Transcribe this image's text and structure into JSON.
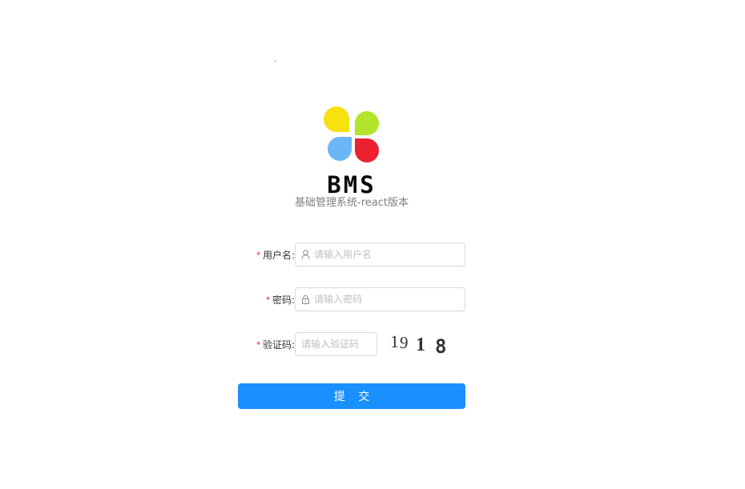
{
  "brand": {
    "name": "BMS",
    "subtitle": "基础管理系统-react版本",
    "logo_colors": [
      "#f7e210",
      "#b1e42a",
      "#6ab6f7",
      "#ec2230"
    ]
  },
  "form": {
    "username": {
      "label": "用户名:",
      "required_mark": "*",
      "placeholder": "请输入用户名",
      "value": "",
      "icon": "user-icon"
    },
    "password": {
      "label": "密码:",
      "required_mark": "*",
      "placeholder": "请输入密码",
      "value": "",
      "icon": "lock-icon"
    },
    "captcha": {
      "label": "验证码:",
      "required_mark": "*",
      "placeholder": "请输入验证码",
      "value": "",
      "image_digits": [
        "1",
        "9",
        "1",
        "8"
      ]
    },
    "submit_label": "提 交"
  },
  "colors": {
    "primary": "#1890ff",
    "required": "#f5222d",
    "border": "#d9d9d9",
    "placeholder": "#bfbfbf"
  }
}
